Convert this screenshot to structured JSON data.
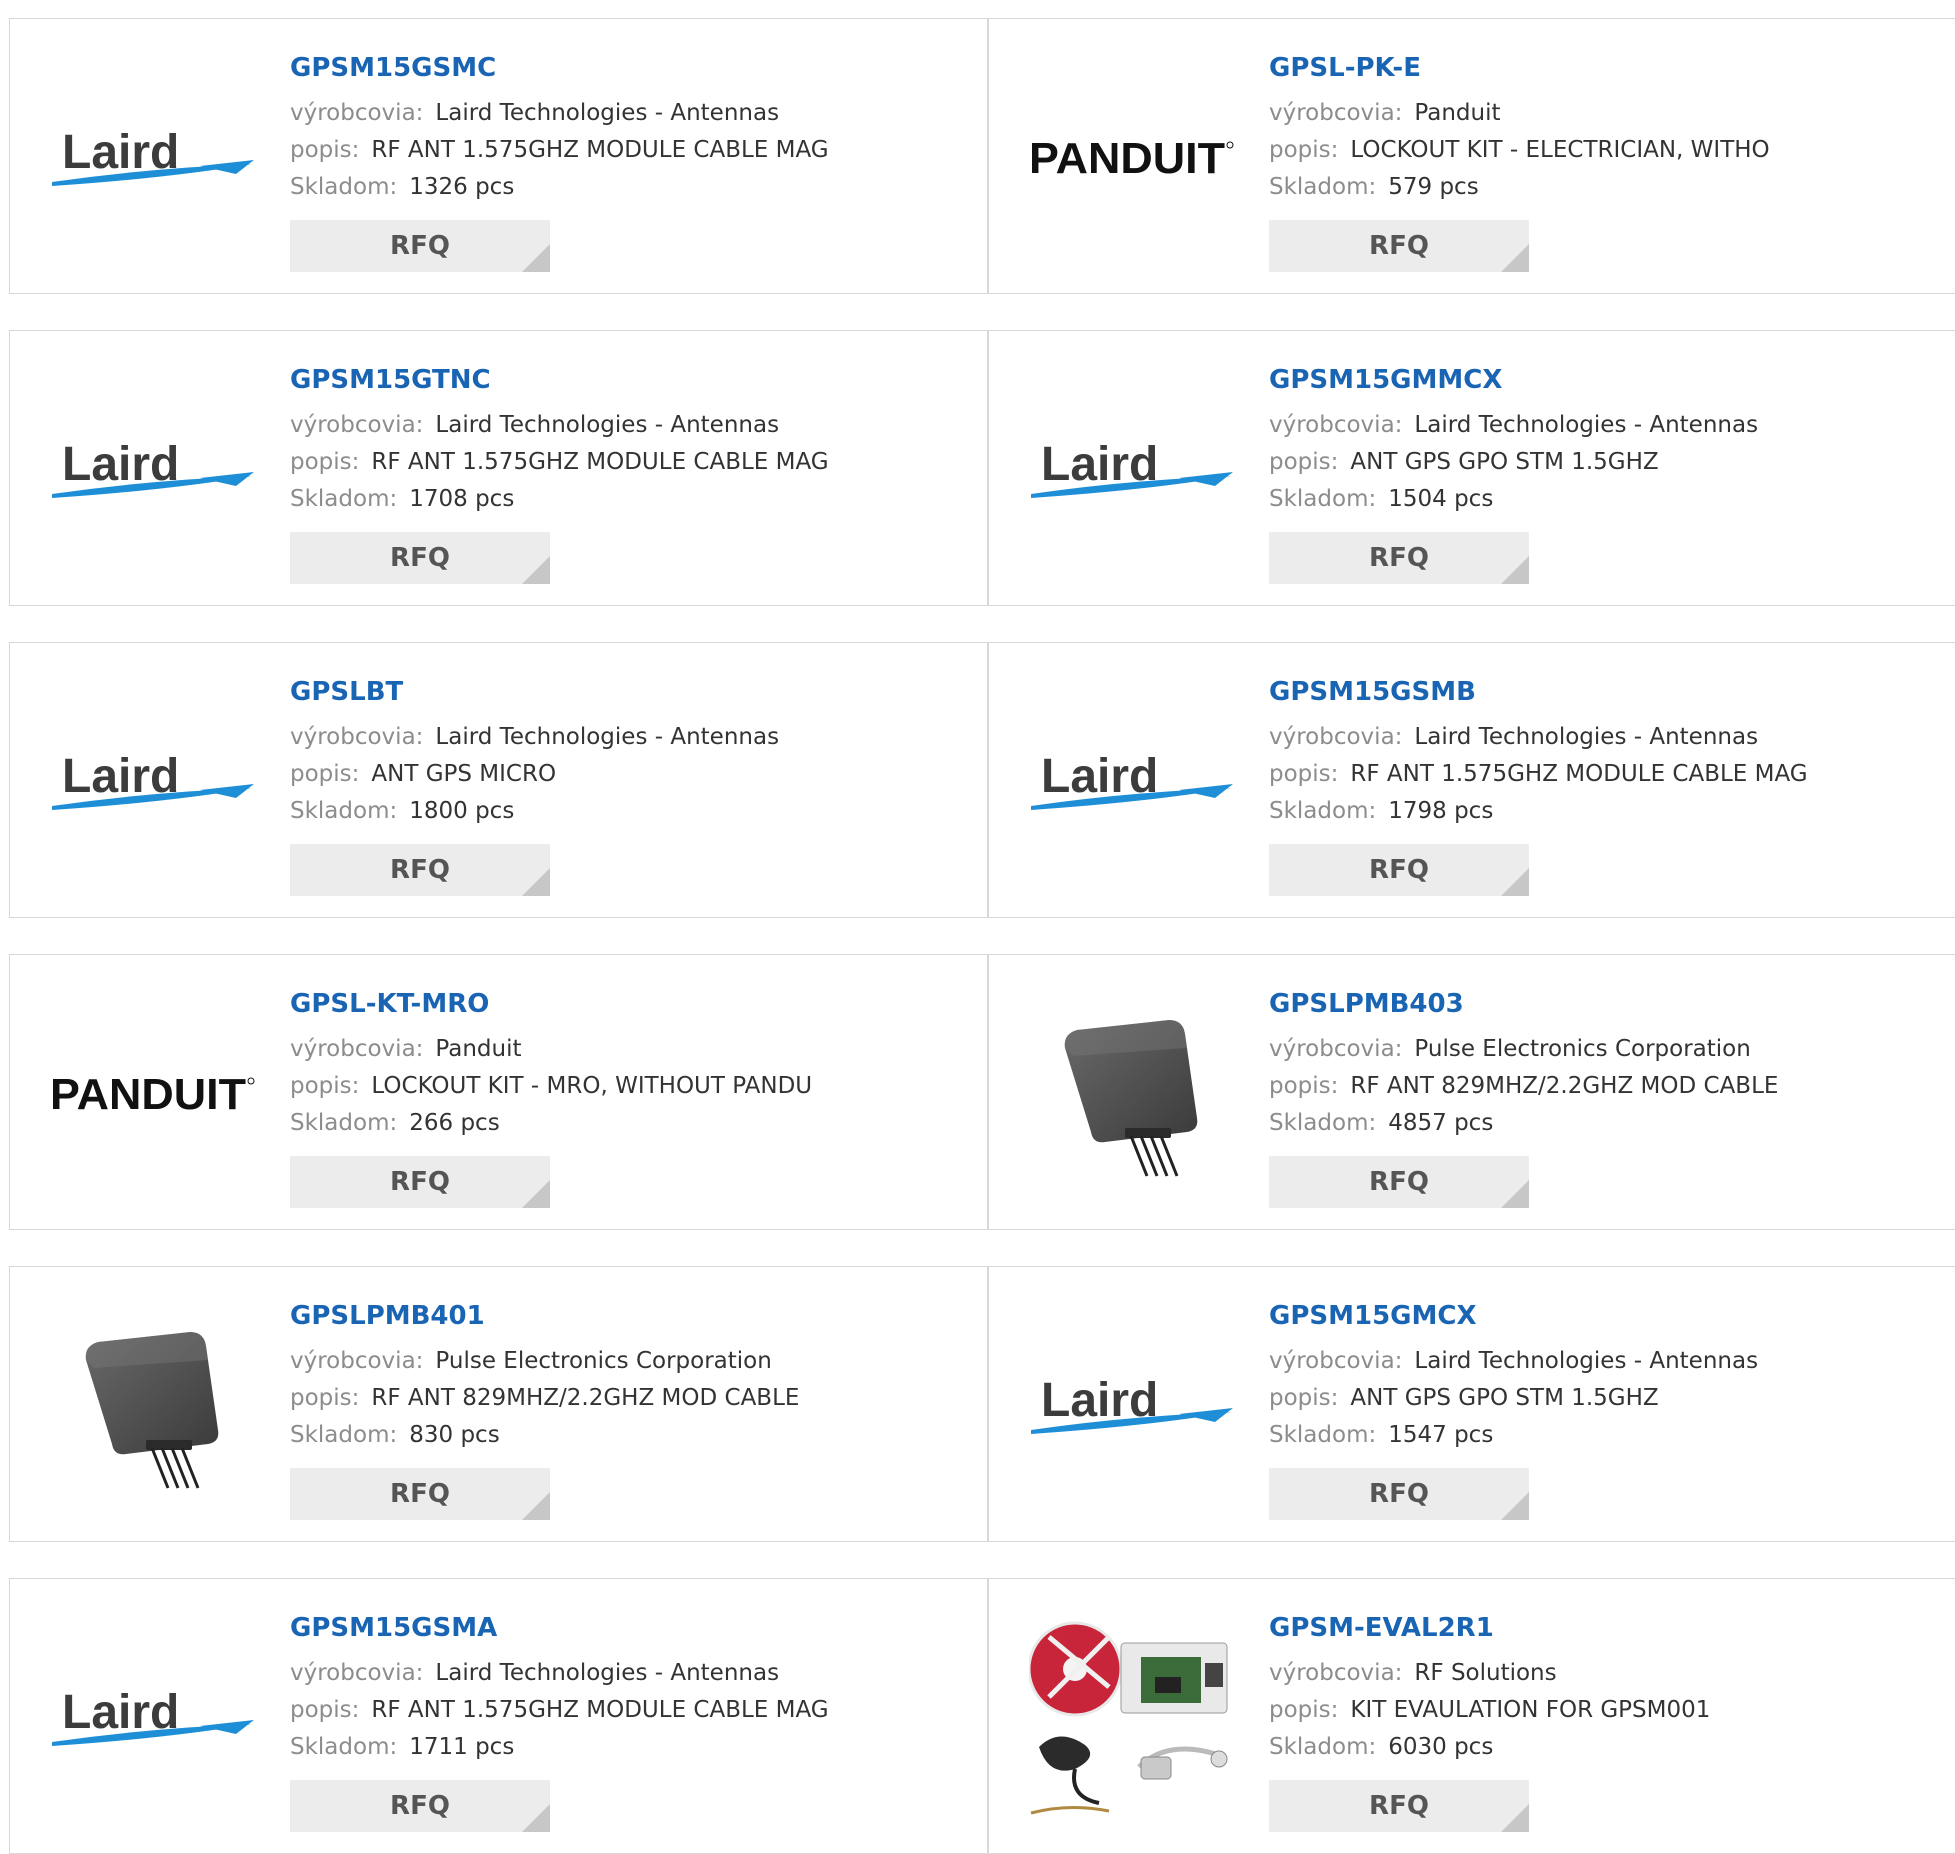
{
  "labels": {
    "manufacturer": "výrobcovia:",
    "description": "popis:",
    "stock": "Skladom:",
    "rfq": "RFQ"
  },
  "colors": {
    "part_link": "#1a64b4",
    "label_gray": "#8c8c8c",
    "laird_blue": "#1e8fd6",
    "rfq_bg": "#ececec"
  },
  "brand_logos": {
    "laird": "Laird",
    "panduit": "PANDUIT"
  },
  "products": [
    {
      "part": "GPSM15GSMC",
      "manufacturer": "Laird Technologies - Antennas",
      "description": "RF ANT 1.575GHZ MODULE CABLE MAG",
      "stock": "1326 pcs",
      "image": "laird-logo"
    },
    {
      "part": "GPSL-PK-E",
      "manufacturer": "Panduit",
      "description": "LOCKOUT KIT - ELECTRICIAN, WITHO",
      "stock": "579 pcs",
      "image": "panduit-logo"
    },
    {
      "part": "GPSM15GTNC",
      "manufacturer": "Laird Technologies - Antennas",
      "description": "RF ANT 1.575GHZ MODULE CABLE MAG",
      "stock": "1708 pcs",
      "image": "laird-logo"
    },
    {
      "part": "GPSM15GMMCX",
      "manufacturer": "Laird Technologies - Antennas",
      "description": "ANT GPS GPO STM 1.5GHZ",
      "stock": "1504 pcs",
      "image": "laird-logo"
    },
    {
      "part": "GPSLBT",
      "manufacturer": "Laird Technologies - Antennas",
      "description": "ANT GPS MICRO",
      "stock": "1800 pcs",
      "image": "laird-logo"
    },
    {
      "part": "GPSM15GSMB",
      "manufacturer": "Laird Technologies - Antennas",
      "description": "RF ANT 1.575GHZ MODULE CABLE MAG",
      "stock": "1798 pcs",
      "image": "laird-logo"
    },
    {
      "part": "GPSL-KT-MRO",
      "manufacturer": "Panduit",
      "description": "LOCKOUT KIT - MRO, WITHOUT PANDU",
      "stock": "266 pcs",
      "image": "panduit-logo"
    },
    {
      "part": "GPSLPMB403",
      "manufacturer": "Pulse Electronics Corporation",
      "description": "RF ANT 829MHZ/2.2GHZ MOD CABLE",
      "stock": "4857 pcs",
      "image": "antenna-photo"
    },
    {
      "part": "GPSLPMB401",
      "manufacturer": "Pulse Electronics Corporation",
      "description": "RF ANT 829MHZ/2.2GHZ MOD CABLE",
      "stock": "830 pcs",
      "image": "antenna-photo"
    },
    {
      "part": "GPSM15GMCX",
      "manufacturer": "Laird Technologies - Antennas",
      "description": "ANT GPS GPO STM 1.5GHZ",
      "stock": "1547 pcs",
      "image": "laird-logo"
    },
    {
      "part": "GPSM15GSMA",
      "manufacturer": "Laird Technologies - Antennas",
      "description": "RF ANT 1.575GHZ MODULE CABLE MAG",
      "stock": "1711 pcs",
      "image": "laird-logo"
    },
    {
      "part": "GPSM-EVAL2R1",
      "manufacturer": "RF Solutions",
      "description": "KIT EVAULATION FOR GPSM001",
      "stock": "6030 pcs",
      "image": "eval-kit-photo"
    }
  ]
}
